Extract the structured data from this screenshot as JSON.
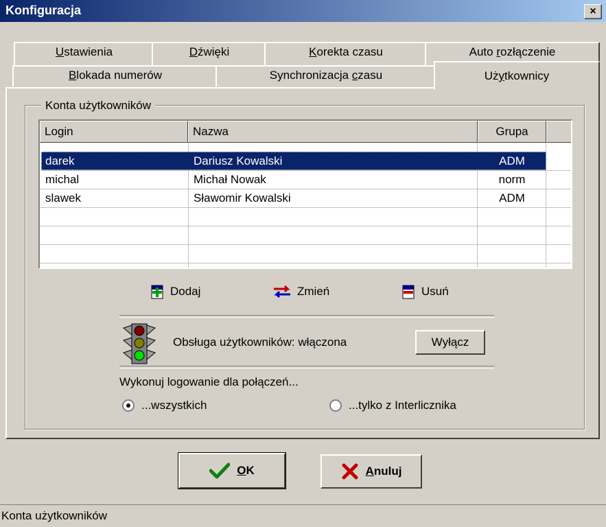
{
  "window": {
    "title": "Konfiguracja",
    "close_glyph": "×"
  },
  "tabs_row1": [
    {
      "label": "Ustawienia",
      "underline": "U",
      "rest": "stawienia"
    },
    {
      "label": "Dźwięki",
      "underline": "D",
      "rest": "źwięki"
    },
    {
      "label": "Korekta czasu",
      "underline": "K",
      "rest": "orekta czasu"
    },
    {
      "label": "Auto rozłączenie",
      "pre": "Auto ",
      "underline": "r",
      "rest": "ozłączenie"
    }
  ],
  "tabs_row2": [
    {
      "label": "Blokada numerów",
      "underline": "B",
      "rest": "lokada numerów"
    },
    {
      "label": "Synchronizacja czasu",
      "pre": "Synchronizacja ",
      "underline": "c",
      "rest": "zasu"
    },
    {
      "label": "Użytkownicy",
      "pre": "Uż",
      "underline": "y",
      "rest": "tkownicy"
    }
  ],
  "group_title": "Konta użytkowników",
  "list": {
    "headers": [
      "Login",
      "Nazwa",
      "Grupa"
    ],
    "rows": [
      {
        "login": "darek",
        "name": "Dariusz Kowalski",
        "group": "ADM",
        "selected": true
      },
      {
        "login": "michal",
        "name": "Michał Nowak",
        "group": "norm",
        "selected": false
      },
      {
        "login": "slawek",
        "name": "Sławomir Kowalski",
        "group": "ADM",
        "selected": false
      }
    ]
  },
  "actions": {
    "add": "Dodaj",
    "edit": "Zmień",
    "delete": "Usuń"
  },
  "user_handling": {
    "status_text": "Obsługa użytkowników: włączona",
    "toggle_button": "Wyłącz"
  },
  "login_mode": {
    "label": "Wykonuj logowanie dla połączeń...",
    "options": [
      "...wszystkich",
      "...tylko z Interlicznika"
    ],
    "selected": 0
  },
  "buttons": {
    "ok_underline": "O",
    "ok_rest": "K",
    "cancel_underline": "A",
    "cancel_rest": "nuluj"
  },
  "status_bar": "Konta użytkowników",
  "colors": {
    "selection": "#0a246a",
    "title_start": "#0a246a",
    "title_end": "#a6caf0",
    "face": "#d4d0c8"
  }
}
